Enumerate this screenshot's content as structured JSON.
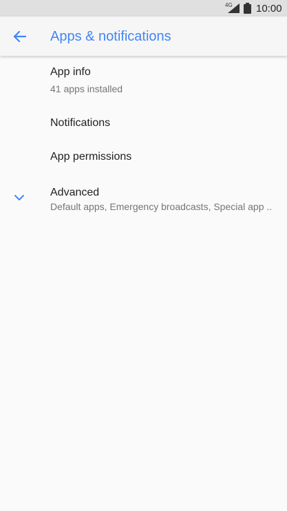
{
  "status_bar": {
    "network": "4G",
    "time": "10:00"
  },
  "app_bar": {
    "title": "Apps & notifications",
    "back_icon": "arrow-back-icon"
  },
  "items": [
    {
      "title": "App info",
      "summary": "41 apps installed"
    },
    {
      "title": "Notifications"
    },
    {
      "title": "App permissions"
    },
    {
      "title": "Advanced",
      "summary": "Default apps, Emergency broadcasts, Special app ..",
      "icon": "chevron-down-icon"
    }
  ],
  "colors": {
    "accent": "#4285f4",
    "primary_text": "#212121",
    "secondary_text": "#757575",
    "status_bar_bg": "#e0e0e0",
    "background": "#fafafa"
  }
}
